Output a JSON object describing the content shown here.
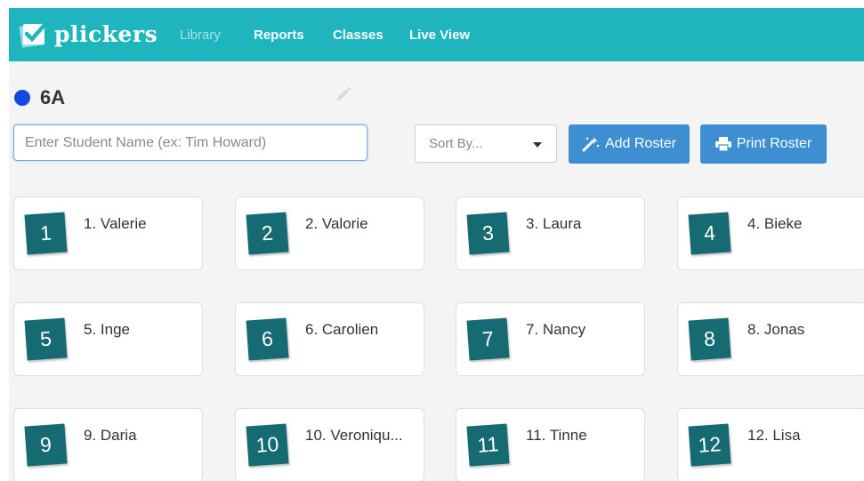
{
  "app": {
    "logo_text": "plickers"
  },
  "nav": {
    "items": [
      {
        "label": "Library",
        "active": true
      },
      {
        "label": "Reports",
        "active": false
      },
      {
        "label": "Classes",
        "active": false
      },
      {
        "label": "Live View",
        "active": false
      }
    ]
  },
  "class_info": {
    "name": "6A",
    "color": "#1548e0"
  },
  "controls": {
    "search_placeholder": "Enter Student Name (ex: Tim Howard)",
    "search_value": "",
    "sort_label": "Sort By...",
    "add_roster_label": "Add Roster",
    "print_roster_label": "Print Roster"
  },
  "students": [
    {
      "card_number": "1",
      "name": "1. Valerie"
    },
    {
      "card_number": "2",
      "name": "2. Valorie"
    },
    {
      "card_number": "3",
      "name": "3. Laura"
    },
    {
      "card_number": "4",
      "name": "4. Bieke"
    },
    {
      "card_number": "5",
      "name": "5. Inge"
    },
    {
      "card_number": "6",
      "name": "6. Carolien"
    },
    {
      "card_number": "7",
      "name": "7. Nancy"
    },
    {
      "card_number": "8",
      "name": "8. Jonas"
    },
    {
      "card_number": "9",
      "name": "9. Daria"
    },
    {
      "card_number": "10",
      "name": "10. Veroniqu..."
    },
    {
      "card_number": "11",
      "name": "11. Tinne"
    },
    {
      "card_number": "12",
      "name": "12. Lisa"
    }
  ],
  "colors": {
    "navbar": "#1fb5bf",
    "button": "#3d8fd1",
    "badge": "#166a72"
  },
  "icons": {
    "logo": "plickers-check-card-icon",
    "edit": "pencil-icon",
    "sort": "chevron-down-icon",
    "add_roster": "magic-wand-icon",
    "print_roster": "printer-icon"
  }
}
